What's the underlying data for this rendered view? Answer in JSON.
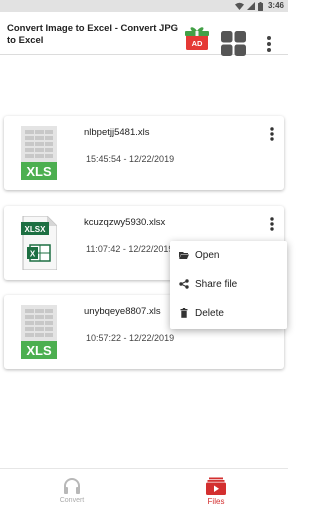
{
  "status_bar": {
    "time": "3:46"
  },
  "toolbar": {
    "title": "Convert Image to Excel - Convert JPG to Excel",
    "ad_badge": "AD",
    "icons": [
      "ad-gift-icon",
      "grid-view-icon",
      "more-vert-icon"
    ]
  },
  "files": [
    {
      "name": "nlbpetjj5481.xls",
      "time": "15:45:54 - 12/22/2019",
      "type_label": "XLS",
      "icon": "xls-file-icon"
    },
    {
      "name": "kcuzqzwy5930.xlsx",
      "time": "11:07:42 - 12/22/2019",
      "type_label": "XLSX",
      "icon": "xlsx-file-icon"
    },
    {
      "name": "unybqeye8807.xls",
      "time": "10:57:22 - 12/22/2019",
      "type_label": "XLS",
      "icon": "xls-file-icon"
    }
  ],
  "context_menu": {
    "items": [
      {
        "label": "Open",
        "icon": "folder-open-icon"
      },
      {
        "label": "Share file",
        "icon": "share-icon"
      },
      {
        "label": "Delete",
        "icon": "trash-icon"
      }
    ]
  },
  "bottom_nav": {
    "convert_label": "Convert",
    "files_label": "Files",
    "active": "Files"
  },
  "colors": {
    "accent_red": "#d32f2f",
    "xls_green": "#4caf50",
    "xlsx_green": "#1d6f42",
    "status_bar": "#e2e2e2",
    "inactive_nav": "#aaaaaa"
  }
}
